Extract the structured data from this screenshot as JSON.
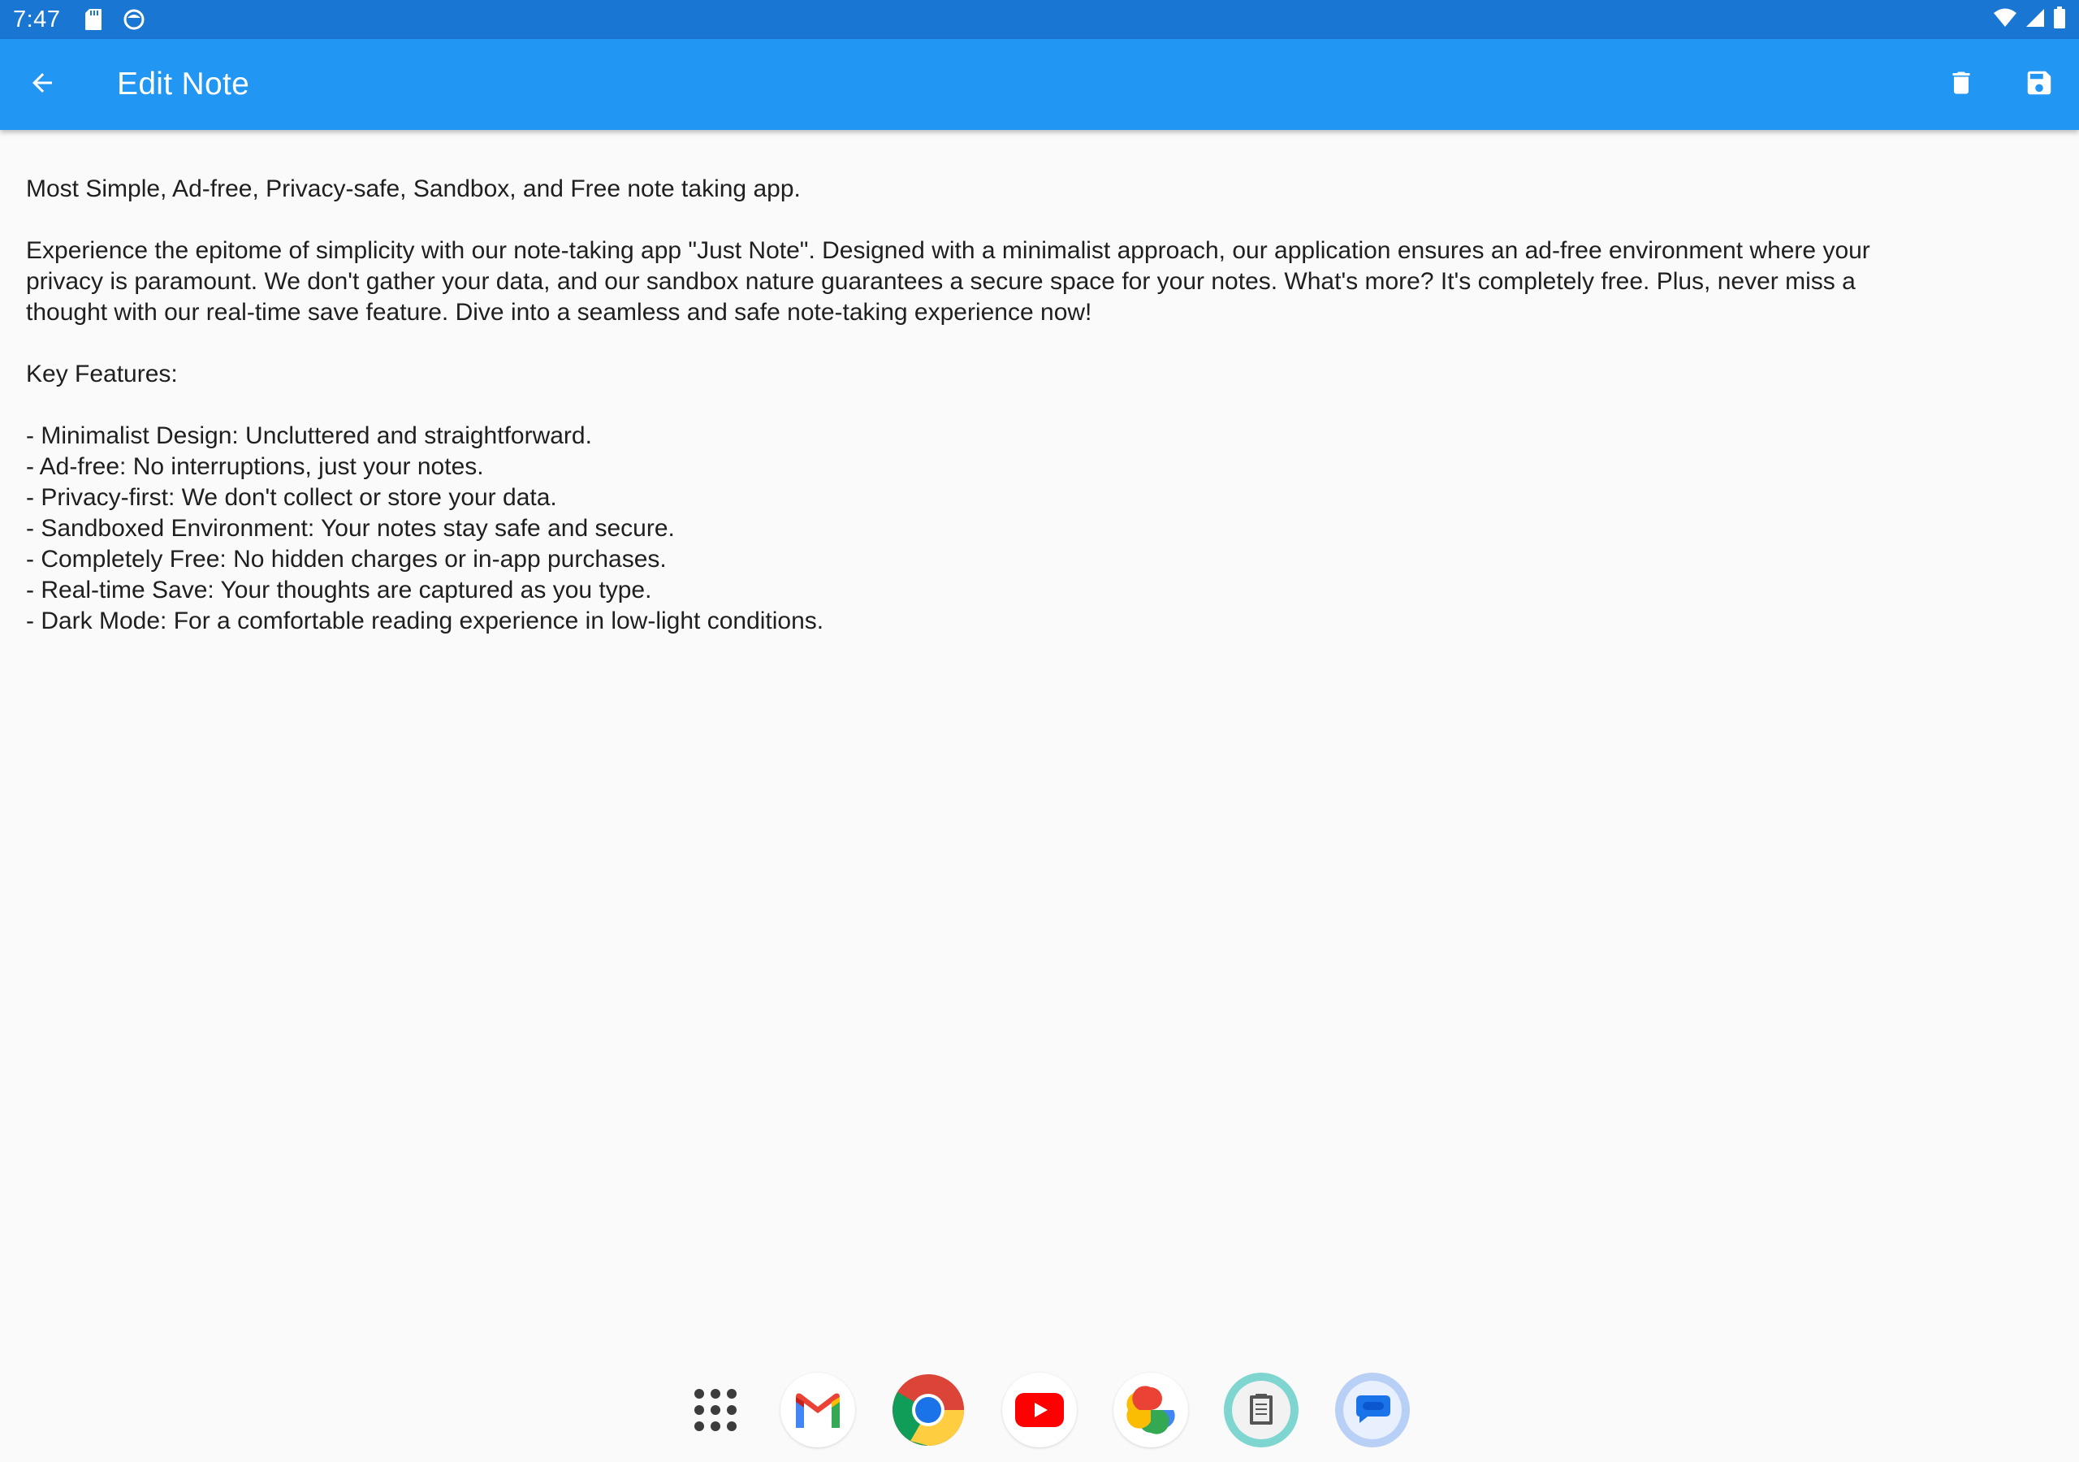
{
  "status_bar": {
    "time": "7:47",
    "left_icons": [
      "sd-card-icon",
      "face-icon"
    ],
    "right_icons": [
      "wifi-icon",
      "signal-icon",
      "battery-icon"
    ]
  },
  "app_bar": {
    "title": "Edit Note",
    "back_icon": "arrow-back-icon",
    "actions": [
      "delete-icon",
      "save-icon"
    ]
  },
  "note": {
    "content": "Most Simple, Ad-free, Privacy-safe, Sandbox, and Free note taking app.\n\nExperience the epitome of simplicity with our note-taking app \"Just Note\". Designed with a minimalist approach, our application ensures an ad-free environment where your\nprivacy is paramount. We don't gather your data, and our sandbox nature guarantees a secure space for your notes. What's more? It's completely free. Plus, never miss a\nthought with our real-time save feature. Dive into a seamless and safe note-taking experience now!\n\nKey Features:\n\n- Minimalist Design: Uncluttered and straightforward.\n- Ad-free: No interruptions, just your notes.\n- Privacy-first: We don't collect or store your data.\n- Sandboxed Environment: Your notes stay safe and secure.\n- Completely Free: No hidden charges or in-app purchases.\n- Real-time Save: Your thoughts are captured as you type.\n- Dark Mode: For a comfortable reading experience in low-light conditions."
  },
  "dock": {
    "apps": [
      "apps-grid-icon",
      "gmail-icon",
      "chrome-icon",
      "youtube-icon",
      "photos-icon",
      "notes-app-icon",
      "messages-icon"
    ]
  },
  "colors": {
    "status_bar": "#1976d2",
    "app_bar": "#2196f3",
    "background": "#fafafa",
    "text": "#1f1f1f"
  }
}
